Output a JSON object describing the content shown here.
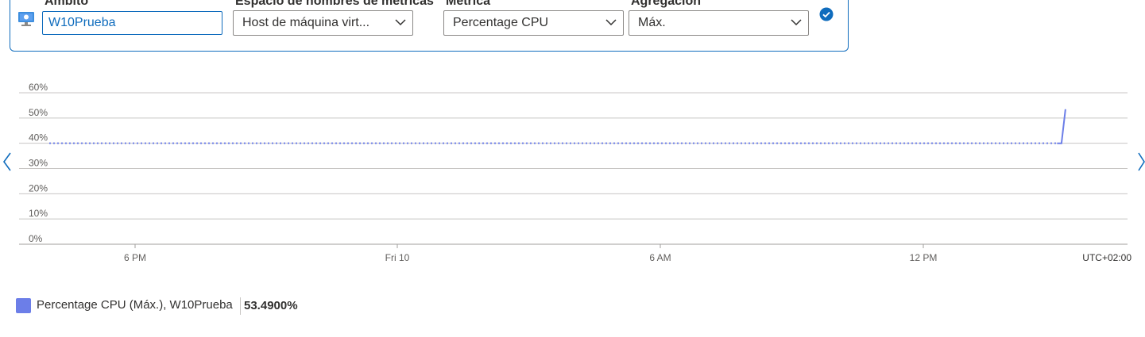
{
  "selector": {
    "scope_label": "Ámbito",
    "scope_value": "W10Prueba",
    "namespace_label": "Espacio de nombres de métricas",
    "namespace_value": "Host de máquina virt...",
    "metric_label": "Métrica",
    "metric_value": "Percentage CPU",
    "aggregation_label": "Agregación",
    "aggregation_value": "Máx.",
    "icons": [
      "virtual-machine-icon",
      "chevron-down-icon",
      "checkmark-circle-icon"
    ],
    "accent_color": "#0f6cbd"
  },
  "navigation": {
    "icons": [
      "chevron-left-icon",
      "chevron-right-icon"
    ]
  },
  "chart_data": {
    "type": "line",
    "y_ticks": [
      "0%",
      "10%",
      "20%",
      "30%",
      "40%",
      "50%",
      "60%"
    ],
    "ylim": [
      0,
      60
    ],
    "x_ticks": [
      "6 PM",
      "Fri 10",
      "6 AM",
      "12 PM"
    ],
    "timezone": "UTC+02:00",
    "grid": true,
    "series": [
      {
        "name": "Percentage CPU (Máx.), W10Prueba",
        "color": "#6c7ee8",
        "points": [
          {
            "t": 0.0,
            "y": 40,
            "dotted": true
          },
          {
            "t": 22.9,
            "y": 40,
            "dotted": true
          },
          {
            "t": 23.0,
            "y": 40
          },
          {
            "t": 23.09,
            "y": 53.49
          }
        ]
      }
    ],
    "x_domain_hours": [
      0,
      24.5
    ],
    "legend": {
      "entry": "Percentage CPU (Máx.), W10Prueba",
      "value": "53.4900%",
      "color": "#6c7ee8",
      "placement": "bottom-left"
    }
  }
}
